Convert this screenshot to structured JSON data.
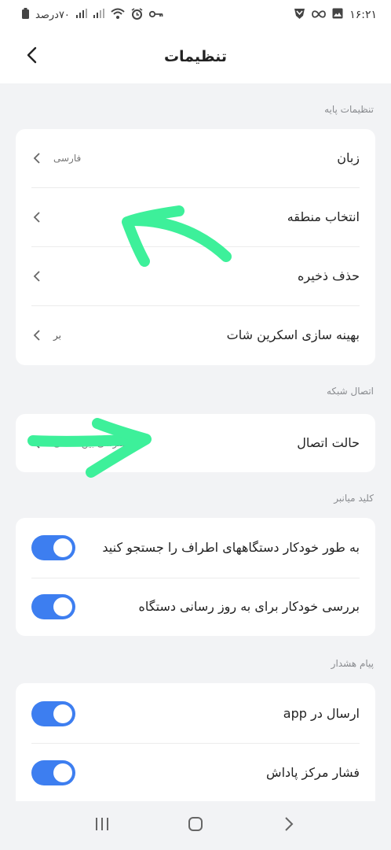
{
  "status_bar": {
    "time": "۱۶:۲۱",
    "battery": "۷۰درصد",
    "left_icons": [
      "battery-icon",
      "signal-icon",
      "signal-icon",
      "wifi-icon",
      "alarm-icon",
      "vpn-key-icon"
    ],
    "right_icons": [
      "shield-icon",
      "infinity-icon",
      "image-icon"
    ]
  },
  "header": {
    "title": "تنظیمات"
  },
  "sections": {
    "basic": {
      "label": "تنظیمات پایه",
      "language_label": "زبان",
      "language_value": "فارسی",
      "region_label": "انتخاب منطقه",
      "clear_storage_label": "حذف ذخیره",
      "screenshot_label": "بهینه سازی اسکرین شات",
      "screenshot_value": "بر"
    },
    "network": {
      "label": "اتصال شبکه",
      "connection_label": "حالت اتصال",
      "connection_value": "دسترسی بین المللی"
    },
    "shortcut": {
      "label": "کلید میانبر",
      "auto_search_label": "به طور خودکار دستگاههای اطراف را جستجو کنید",
      "auto_update_label": "بررسی خودکار برای به روز رسانی دستگاه"
    },
    "alert": {
      "label": "پیام هشدار",
      "send_app_label": "ارسال در app",
      "reward_push_label": "فشار مرکز پاداش"
    }
  },
  "toggles": {
    "auto_search": true,
    "auto_update": true,
    "send_app": true,
    "reward_push": true
  },
  "colors": {
    "accent": "#3d7ef0",
    "annotation": "#3df09a",
    "background": "#f2f3f5"
  }
}
